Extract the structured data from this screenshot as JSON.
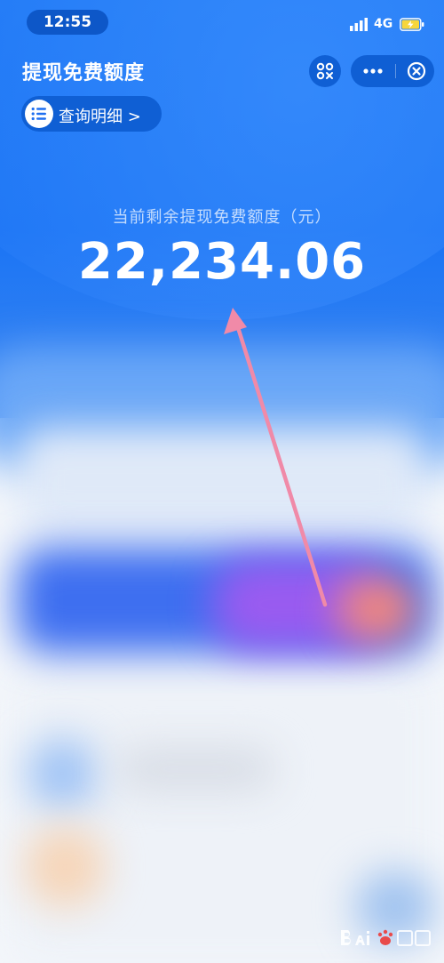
{
  "status_bar": {
    "time": "12:55",
    "network": "4G",
    "icons": [
      "signal-icon",
      "battery-charging-icon"
    ]
  },
  "header": {
    "title": "提现免费额度",
    "scan_icon": "scan-icon",
    "more_icon": "more-dots-icon",
    "close_icon": "close-circle-icon"
  },
  "query": {
    "label": "查询明细 >",
    "icon": "list-icon"
  },
  "balance": {
    "caption": "当前剩余提现免费额度（元）",
    "amount": "22,234.06"
  },
  "annotation": {
    "arrow_color": "#f08aa8"
  },
  "watermark": {
    "text": "Bai 经验"
  },
  "colors": {
    "hero_blue": "#1f7af5",
    "capsule_blue": "#0f5fd4"
  }
}
